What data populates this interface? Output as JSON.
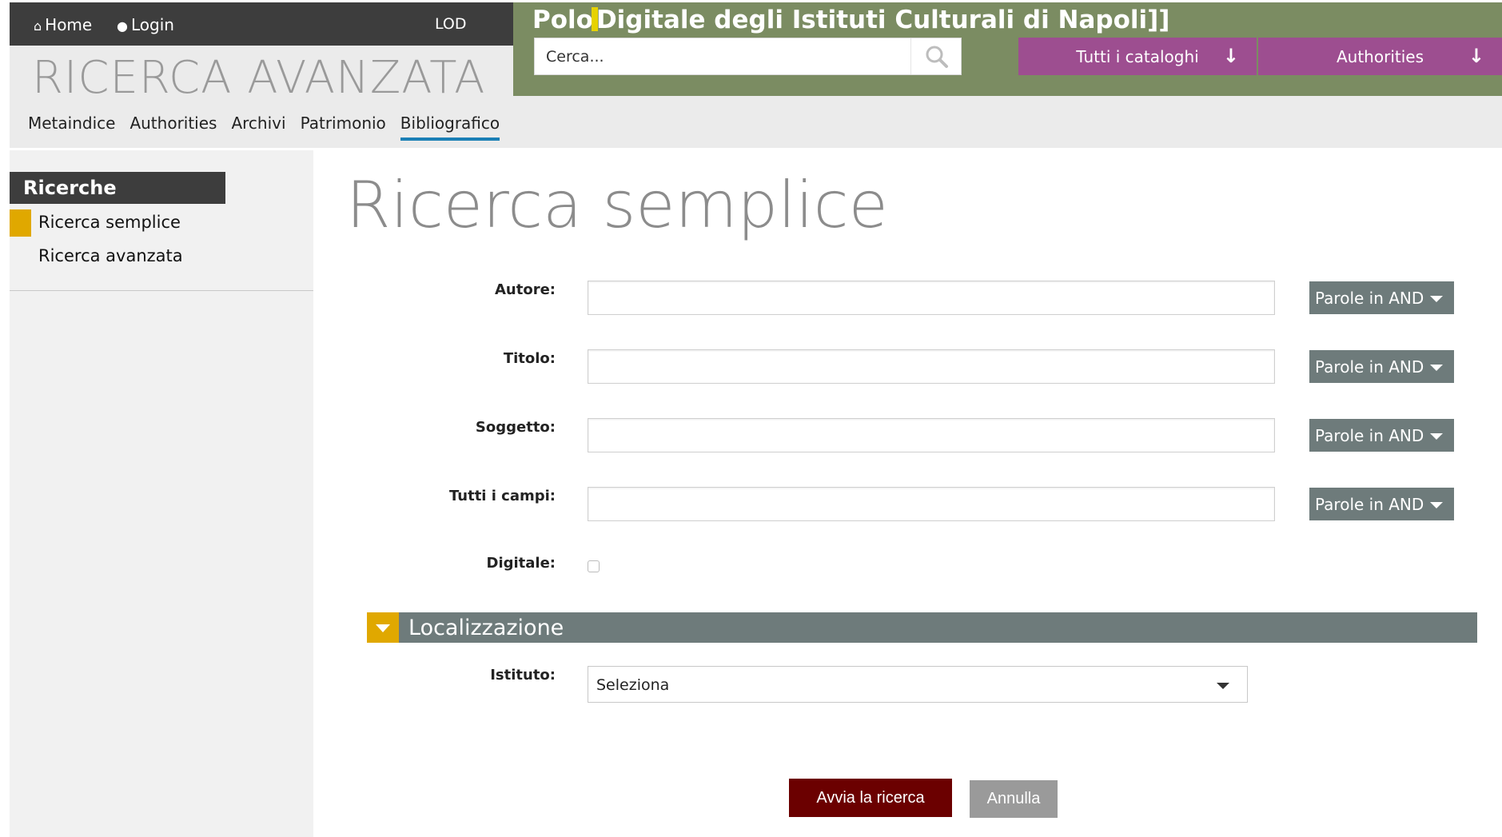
{
  "header": {
    "home_label": "Home",
    "login_label": "Login",
    "lod_label": "LOD",
    "section_title": "RICERCA AVANZATA",
    "tabs": [
      {
        "label": "Metaindice",
        "active": false
      },
      {
        "label": "Authorities",
        "active": false
      },
      {
        "label": "Archivi",
        "active": false
      },
      {
        "label": "Patrimonio",
        "active": false
      },
      {
        "label": "Bibliografico",
        "active": true
      }
    ]
  },
  "banner": {
    "title_before_cursor": "Polo",
    "title_after_cursor": "Digitale degli Istituti Culturali di Napoli]]",
    "search_placeholder": "Cerca...",
    "catalog_dropdown_label": "Tutti i cataloghi",
    "authorities_dropdown_label": "Authorities",
    "accent_color": "#9d4e90",
    "banner_color": "#7b8c62"
  },
  "sidebar": {
    "heading": "Ricerche",
    "items": [
      {
        "label": "Ricerca semplice",
        "active": true
      },
      {
        "label": "Ricerca avanzata",
        "active": false
      }
    ],
    "marker_color": "#e0a800"
  },
  "main": {
    "title": "Ricerca semplice",
    "fields": [
      {
        "label": "Autore:",
        "value": "",
        "operator": "Parole in AND"
      },
      {
        "label": "Titolo:",
        "value": "",
        "operator": "Parole in AND"
      },
      {
        "label": "Soggetto:",
        "value": "",
        "operator": "Parole in AND"
      },
      {
        "label": "Tutti i campi:",
        "value": "",
        "operator": "Parole in AND"
      }
    ],
    "digitale_label": "Digitale:",
    "digitale_checked": false,
    "localizzazione_title": "Localizzazione",
    "istituto_label": "Istituto:",
    "istituto_selected": "Seleziona",
    "submit_label": "Avvia la ricerca",
    "cancel_label": "Annulla",
    "submit_color": "#6b0000"
  }
}
